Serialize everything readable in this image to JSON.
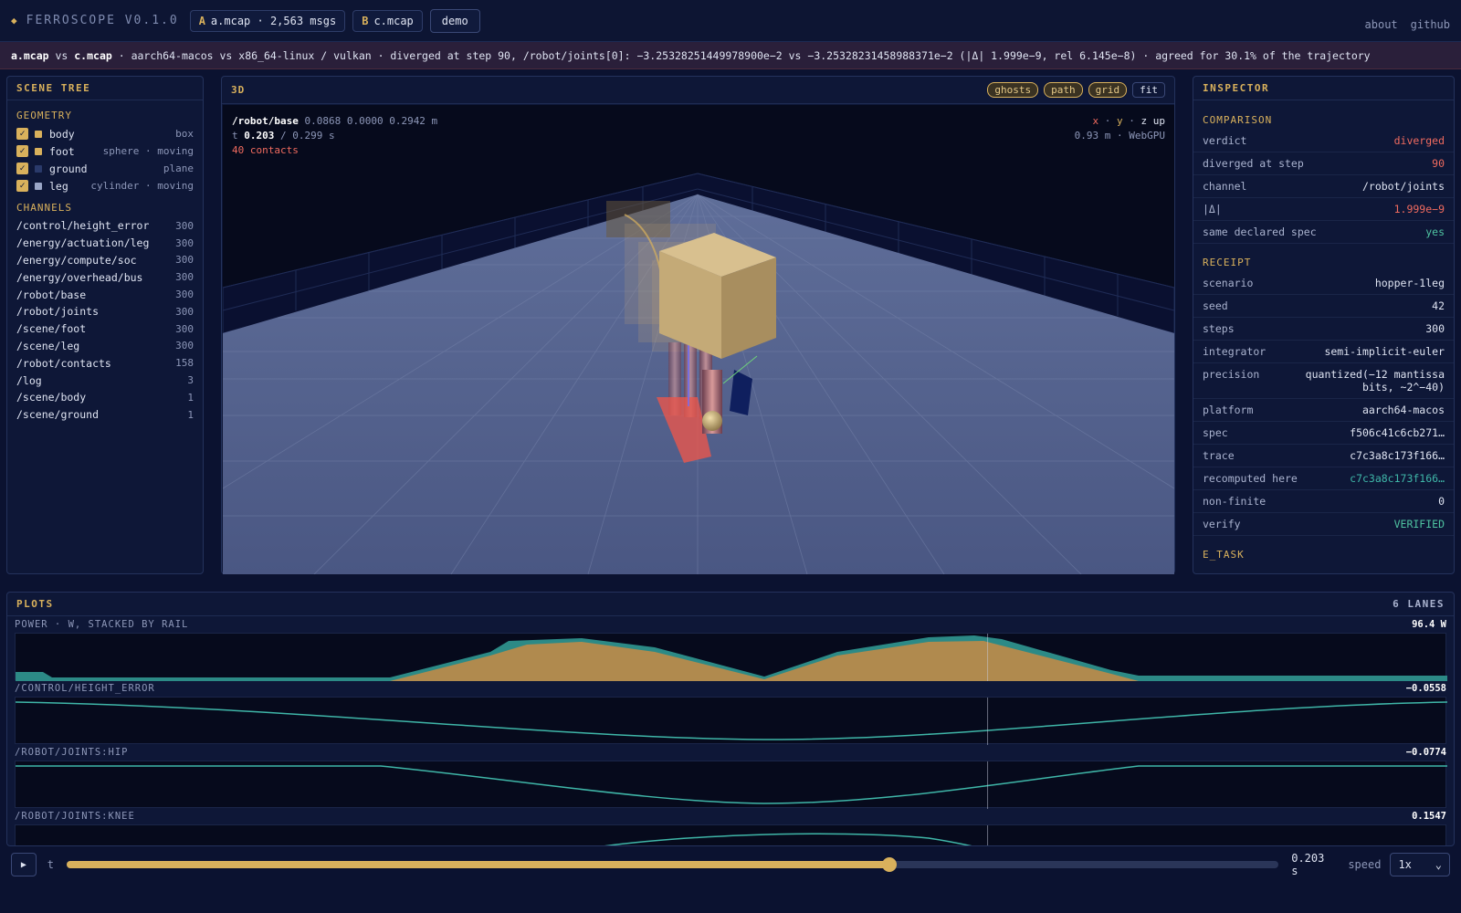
{
  "app": {
    "name": "FERROSCOPE V0.1.0",
    "file_a_tag": "A",
    "file_a": "a.mcap · 2,563 msgs",
    "file_b_tag": "B",
    "file_b": "c.mcap",
    "demo": "demo",
    "links": [
      "about",
      "github"
    ]
  },
  "banner": {
    "a": "a.mcap",
    "vs1": " vs ",
    "b": "c.mcap",
    "rest": " · aarch64-macos vs x86_64-linux / vulkan · diverged at step 90, /robot/joints[0]: −3.25328251449978900e−2 vs −3.25328231458988371e−2 (|Δ| 1.999e−9, rel 6.145e−8) · agreed for 30.1% of the trajectory"
  },
  "scene_tree": {
    "title": "SCENE TREE",
    "geometry_title": "GEOMETRY",
    "geometry": [
      {
        "name": "body",
        "meta": "box",
        "color": "#d9b15c"
      },
      {
        "name": "foot",
        "meta": "sphere · moving",
        "color": "#d9b15c"
      },
      {
        "name": "ground",
        "meta": "plane",
        "color": "#2a3a6a"
      },
      {
        "name": "leg",
        "meta": "cylinder · moving",
        "color": "#9aa6c6"
      }
    ],
    "channels_title": "CHANNELS",
    "channels": [
      {
        "name": "/control/height_error",
        "count": "300"
      },
      {
        "name": "/energy/actuation/leg",
        "count": "300"
      },
      {
        "name": "/energy/compute/soc",
        "count": "300"
      },
      {
        "name": "/energy/overhead/bus",
        "count": "300"
      },
      {
        "name": "/robot/base",
        "count": "300"
      },
      {
        "name": "/robot/joints",
        "count": "300"
      },
      {
        "name": "/scene/foot",
        "count": "300"
      },
      {
        "name": "/scene/leg",
        "count": "300"
      },
      {
        "name": "/robot/contacts",
        "count": "158"
      },
      {
        "name": "/log",
        "count": "3"
      },
      {
        "name": "/scene/body",
        "count": "1"
      },
      {
        "name": "/scene/ground",
        "count": "1"
      }
    ]
  },
  "viewport": {
    "title": "3D",
    "buttons": [
      "ghosts",
      "path",
      "grid"
    ],
    "fit": "fit",
    "hud_base_label": "/robot/base",
    "hud_base_values": " 0.0868 0.0000 0.2942 m",
    "hud_t_label": "t ",
    "hud_t_value": "0.203",
    "hud_t_total": " / 0.299 s",
    "hud_contacts": "40 contacts",
    "axis_x": "x",
    "axis_sep1": " · ",
    "axis_y": "y",
    "axis_sep2": " · ",
    "axis_z": "z up",
    "scale_info": "0.93 m · WebGPU"
  },
  "inspector": {
    "title": "INSPECTOR",
    "comparison_title": "COMPARISON",
    "comparison": [
      {
        "k": "verdict",
        "v": "diverged",
        "tone": "red"
      },
      {
        "k": "diverged at step",
        "v": "90",
        "tone": "red"
      },
      {
        "k": "channel",
        "v": "/robot/joints",
        "tone": ""
      },
      {
        "k": "|Δ|",
        "v": "1.999e−9",
        "tone": "red"
      },
      {
        "k": "same declared spec",
        "v": "yes",
        "tone": "green"
      }
    ],
    "receipt_title": "RECEIPT",
    "receipt": [
      {
        "k": "scenario",
        "v": "hopper-1leg",
        "tone": ""
      },
      {
        "k": "seed",
        "v": "42",
        "tone": ""
      },
      {
        "k": "steps",
        "v": "300",
        "tone": ""
      },
      {
        "k": "integrator",
        "v": "semi-implicit-euler",
        "tone": ""
      },
      {
        "k": "precision",
        "v": "quantized(−12 mantissa bits, ~2^−40)",
        "tone": ""
      },
      {
        "k": "platform",
        "v": "aarch64-macos",
        "tone": ""
      },
      {
        "k": "spec",
        "v": "f506c41c6cb271…",
        "tone": ""
      },
      {
        "k": "trace",
        "v": "c7c3a8c173f166…",
        "tone": ""
      },
      {
        "k": "recomputed here",
        "v": "c7c3a8c173f166…",
        "tone": "teal"
      },
      {
        "k": "non-finite",
        "v": "0",
        "tone": ""
      },
      {
        "k": "verify",
        "v": "VERIFIED",
        "tone": "green"
      }
    ],
    "etask_title": "E_TASK"
  },
  "plots": {
    "title": "PLOTS",
    "lanes_count": "6 LANES",
    "cursor_t": 0.203,
    "t_max": 0.299,
    "lanes": [
      {
        "title": "POWER · W, STACKED BY RAIL",
        "value": "96.4 W"
      },
      {
        "title": "/CONTROL/HEIGHT_ERROR",
        "value": "−0.0558"
      },
      {
        "title": "/ROBOT/JOINTS:HIP",
        "value": "−0.0774"
      },
      {
        "title": "/ROBOT/JOINTS:KNEE",
        "value": "0.1547"
      }
    ]
  },
  "timeline": {
    "play": "▶",
    "t_label": "t",
    "progress": 0.679,
    "value": "0.203 s",
    "speed_label": "speed",
    "speed": "1x"
  },
  "colors": {
    "accent": "#d9b15c",
    "diverged": "#f06b5f",
    "ok": "#4fc3a1",
    "trace": "#3fb6a8"
  }
}
